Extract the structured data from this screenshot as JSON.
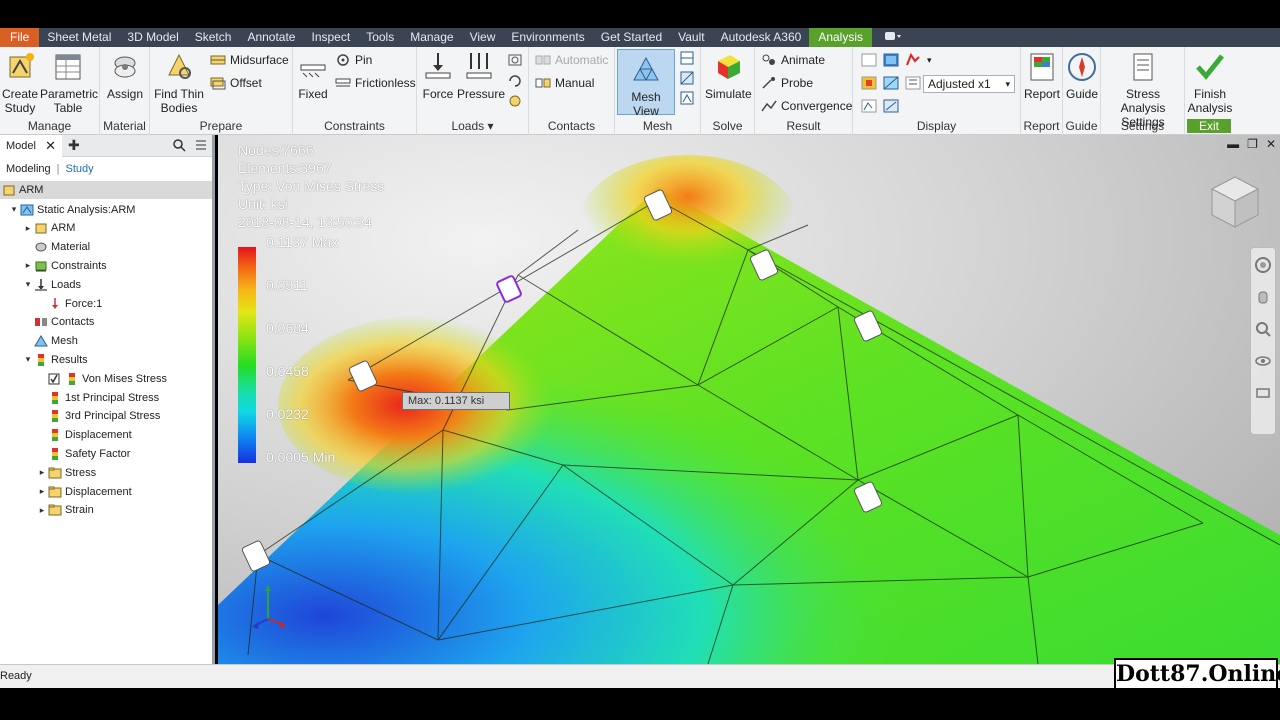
{
  "menu": {
    "items": [
      "File",
      "Sheet Metal",
      "3D Model",
      "Sketch",
      "Annotate",
      "Inspect",
      "Tools",
      "Manage",
      "View",
      "Environments",
      "Get Started",
      "Vault",
      "Autodesk A360",
      "Analysis"
    ],
    "active": "Analysis",
    "accent_file": "#d95f22",
    "accent_active": "#5aa02c"
  },
  "ribbon": {
    "manage": {
      "title": "Manage",
      "create_study": [
        "Create",
        "Study"
      ],
      "parametric_table": [
        "Parametric",
        "Table"
      ]
    },
    "material": {
      "title": "Material",
      "assign": "Assign"
    },
    "prepare": {
      "title": "Prepare",
      "find_thin_bodies": [
        "Find Thin",
        "Bodies"
      ],
      "midsurface": "Midsurface",
      "offset": "Offset"
    },
    "constraints": {
      "title": "Constraints",
      "fixed": "Fixed",
      "pin": "Pin",
      "frictionless": "Frictionless"
    },
    "loads": {
      "title": "Loads",
      "force": "Force",
      "pressure": "Pressure"
    },
    "contacts": {
      "title": "Contacts",
      "automatic": "Automatic",
      "manual": "Manual"
    },
    "mesh": {
      "title": "Mesh",
      "mesh_view": "Mesh View"
    },
    "solve": {
      "title": "Solve",
      "simulate": "Simulate"
    },
    "result": {
      "title": "Result",
      "animate": "Animate",
      "probe": "Probe",
      "convergence": "Convergence"
    },
    "display": {
      "title": "Display",
      "adjusted": "Adjusted x1"
    },
    "report": {
      "title": "Report",
      "report": "Report"
    },
    "guide": {
      "title": "Guide",
      "guide": "Guide"
    },
    "settings": {
      "title": "Settings",
      "stress_analysis_settings": [
        "Stress Analysis",
        "Settings"
      ]
    },
    "exit": {
      "title": "Exit",
      "finish_analysis": [
        "Finish",
        "Analysis"
      ]
    }
  },
  "browser": {
    "tab": "Model",
    "sub_modeling": "Modeling",
    "sub_study": "Study",
    "root": "ARM",
    "tree": [
      {
        "label": "Static Analysis:ARM",
        "icon": "analysis-icon",
        "exp": "▾"
      },
      {
        "label": "ARM",
        "icon": "part-icon",
        "exp": "▸"
      },
      {
        "label": "Material",
        "icon": "material-icon",
        "exp": ""
      },
      {
        "label": "Constraints",
        "icon": "constraints-icon",
        "exp": "▸"
      },
      {
        "label": "Loads",
        "icon": "loads-icon",
        "exp": "▾"
      },
      {
        "label": "Force:1",
        "icon": "force-icon",
        "exp": ""
      },
      {
        "label": "Contacts",
        "icon": "contacts-icon",
        "exp": ""
      },
      {
        "label": "Mesh",
        "icon": "mesh-icon",
        "exp": ""
      },
      {
        "label": "Results",
        "icon": "results-icon",
        "exp": "▾"
      },
      {
        "label": "Von Mises Stress",
        "icon": "result-checked-icon",
        "exp": ""
      },
      {
        "label": "1st Principal Stress",
        "icon": "result-icon",
        "exp": ""
      },
      {
        "label": "3rd Principal Stress",
        "icon": "result-icon",
        "exp": ""
      },
      {
        "label": "Displacement",
        "icon": "result-icon",
        "exp": ""
      },
      {
        "label": "Safety Factor",
        "icon": "result-icon",
        "exp": ""
      },
      {
        "label": "Stress",
        "icon": "folder-icon",
        "exp": "▸"
      },
      {
        "label": "Displacement",
        "icon": "folder-icon",
        "exp": "▸"
      },
      {
        "label": "Strain",
        "icon": "folder-icon",
        "exp": "▸"
      }
    ]
  },
  "viewport": {
    "nodes": "Nodes:7666",
    "elements": "Elements:3967",
    "type": "Type: Von Mises Stress",
    "unit": "Unit: ksi",
    "timestamp": "2018-08-14, 13:50:54",
    "legend": [
      "0.1137 Max",
      "0.0911",
      "0.0684",
      "0.0458",
      "0.0232",
      "0.0005 Min"
    ],
    "max_tooltip": "Max: 0.1137 ksi"
  },
  "status": {
    "text": "Ready"
  },
  "watermark": "Dott87.Online"
}
